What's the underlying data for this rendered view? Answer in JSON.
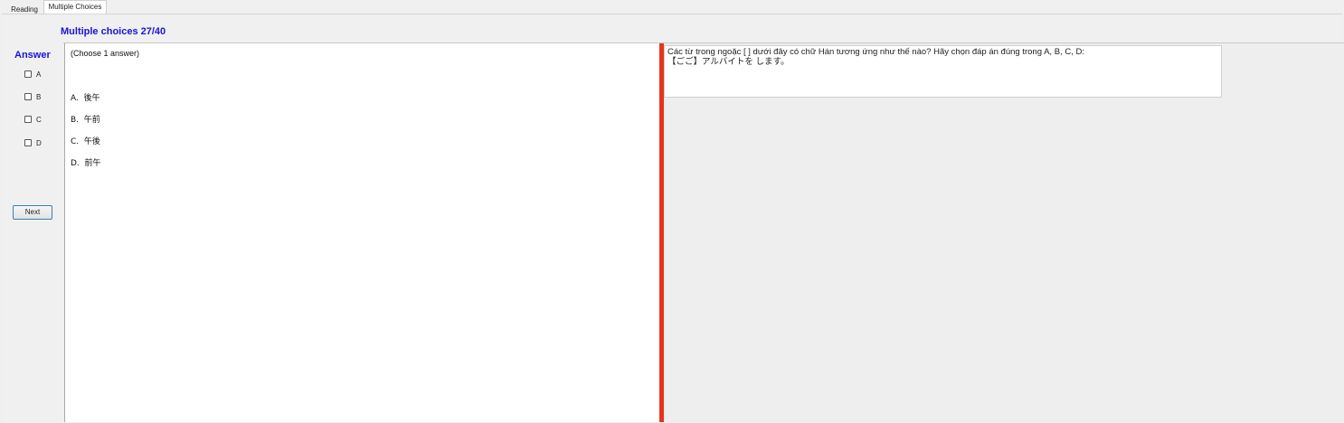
{
  "tabs": [
    {
      "label": "Reading"
    },
    {
      "label": "Multiple Choices"
    }
  ],
  "title": "Multiple choices 27/40",
  "answer": {
    "label": "Answer",
    "options": [
      "A",
      "B",
      "C",
      "D"
    ]
  },
  "next_label": "Next",
  "instruction": "(Choose 1 answer)",
  "choices": [
    "A.  後午",
    "B.  午前",
    "C.  午後",
    "D.  前午"
  ],
  "question": {
    "line1": "Các từ trong ngoặc [    ] dưới đây có chữ Hán tương ứng như thế nào? Hãy chọn đáp án đúng trong A, B, C, D:",
    "line2": "【ごご】アルバイトを  します。"
  },
  "colors": {
    "accent": "#1a14d6",
    "divider": "#e8331b"
  }
}
